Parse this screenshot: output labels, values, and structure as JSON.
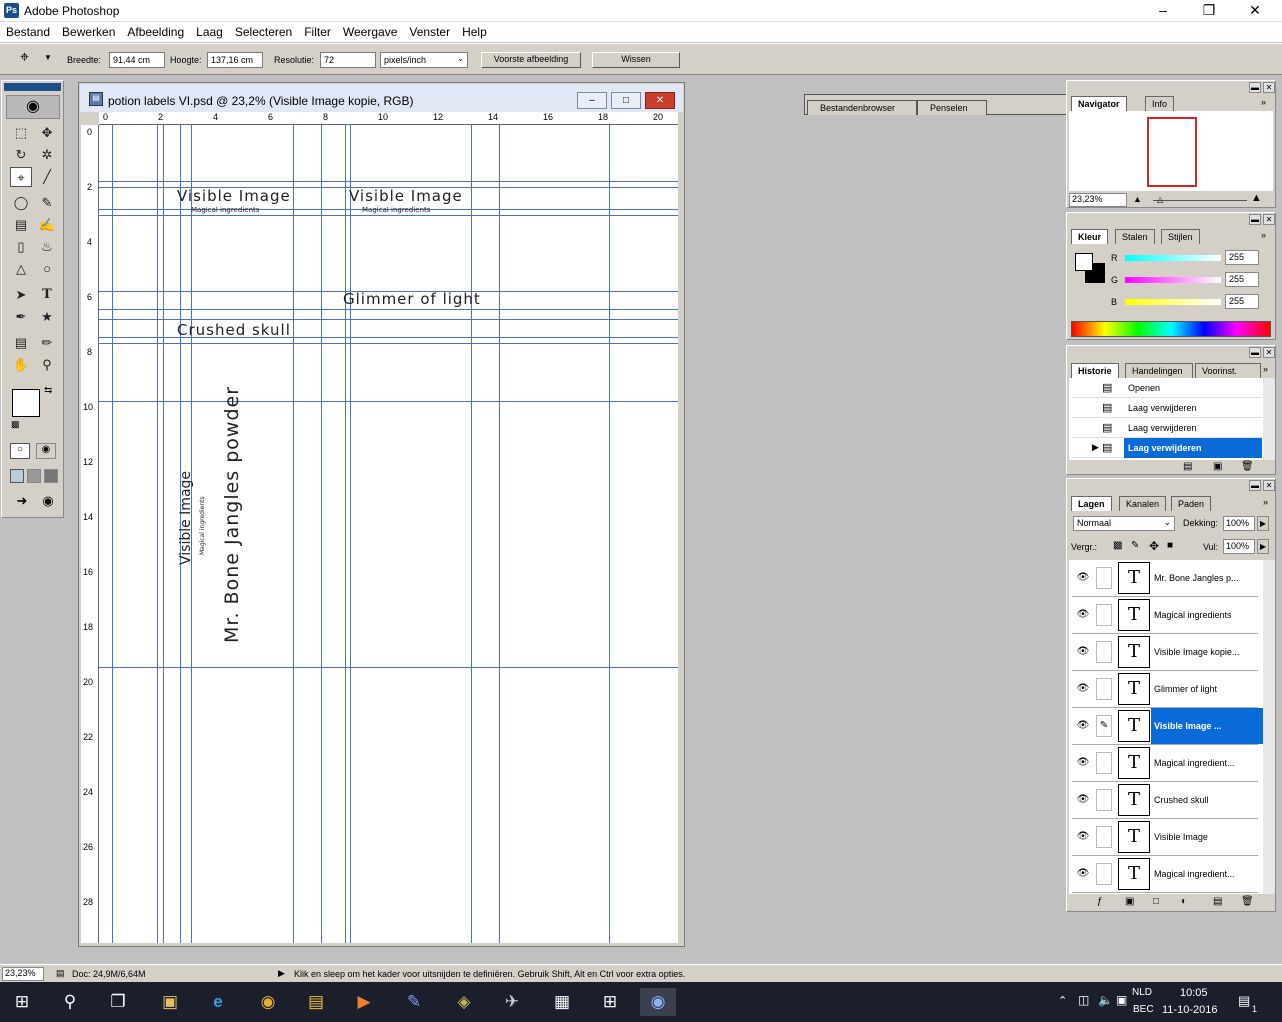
{
  "app": {
    "title": "Adobe Photoshop"
  },
  "menu": [
    "Bestand",
    "Bewerken",
    "Afbeelding",
    "Laag",
    "Selecteren",
    "Filter",
    "Weergave",
    "Venster",
    "Help"
  ],
  "options": {
    "width_label": "Breedte:",
    "width_value": "91,44 cm",
    "height_label": "Hoogte:",
    "height_value": "137,16 cm",
    "resolution_label": "Resolutie:",
    "resolution_value": "72",
    "unit_value": "pixels/inch",
    "front_image_button": "Voorste afbeelding",
    "clear_button": "Wissen"
  },
  "palette_well": {
    "tabs": [
      "Bestandenbrowser",
      "Penselen"
    ]
  },
  "document": {
    "title": "potion labels VI.psd @ 23,2% (Visible Image kopie, RGB)",
    "ruler_h": [
      "0",
      "2",
      "4",
      "6",
      "8",
      "10",
      "12",
      "14",
      "16",
      "18",
      "20"
    ],
    "ruler_v": [
      "0",
      "2",
      "4",
      "6",
      "8",
      "10",
      "12",
      "14",
      "16",
      "18",
      "20",
      "22",
      "24",
      "26",
      "28"
    ],
    "texts": {
      "label1_title": "Visible Image",
      "label1_sub": "Magical ingredients",
      "label2_title": "Visible Image",
      "label2_sub": "Magical ingredients",
      "glimmer": "Glimmer of light",
      "crushed": "Crushed skull",
      "vert_title": "Visible Image",
      "vert_sub": "Magical ingredients",
      "vert_bone": "Mr. Bone Jangles powder"
    }
  },
  "navigator": {
    "tabs": [
      "Navigator",
      "Info"
    ],
    "zoom": "23,23%"
  },
  "color": {
    "tabs": [
      "Kleur",
      "Stalen",
      "Stijlen"
    ],
    "r_label": "R",
    "g_label": "G",
    "b_label": "B",
    "r": "255",
    "g": "255",
    "b": "255"
  },
  "history": {
    "tabs": [
      "Historie",
      "Handelingen",
      "Voorinst. ger."
    ],
    "items": [
      "Openen",
      "Laag verwijderen",
      "Laag verwijderen",
      "Laag verwijderen"
    ],
    "selected_index": 3
  },
  "layers": {
    "tabs": [
      "Lagen",
      "Kanalen",
      "Paden"
    ],
    "blend_mode": "Normaal",
    "opacity_label": "Dekking:",
    "opacity": "100%",
    "lock_label": "Vergr.:",
    "fill_label": "Vul:",
    "fill": "100%",
    "items": [
      "Mr. Bone Jangles p...",
      "Magical ingredients",
      "Visible Image kopie...",
      "Glimmer of light",
      "Visible Image ...",
      "Magical ingredient...",
      "Crushed skull",
      "Visible Image",
      "Magical ingredient..."
    ],
    "selected_index": 4
  },
  "status": {
    "zoom": "23,23%",
    "doc": "Doc: 24,9M/6,64M",
    "hint": "Klik en sleep om het kader voor uitsnijden te definiëren. Gebruik Shift, Alt en Ctrl voor extra opties."
  },
  "taskbar": {
    "lang1": "NLD",
    "lang2": "BEC",
    "time": "10:05",
    "date": "11-10-2016",
    "notif": "1"
  },
  "colors": {
    "selection": "#0a6ad8",
    "guide": "#4a6fd1",
    "chrome": "#d4d0c8"
  }
}
